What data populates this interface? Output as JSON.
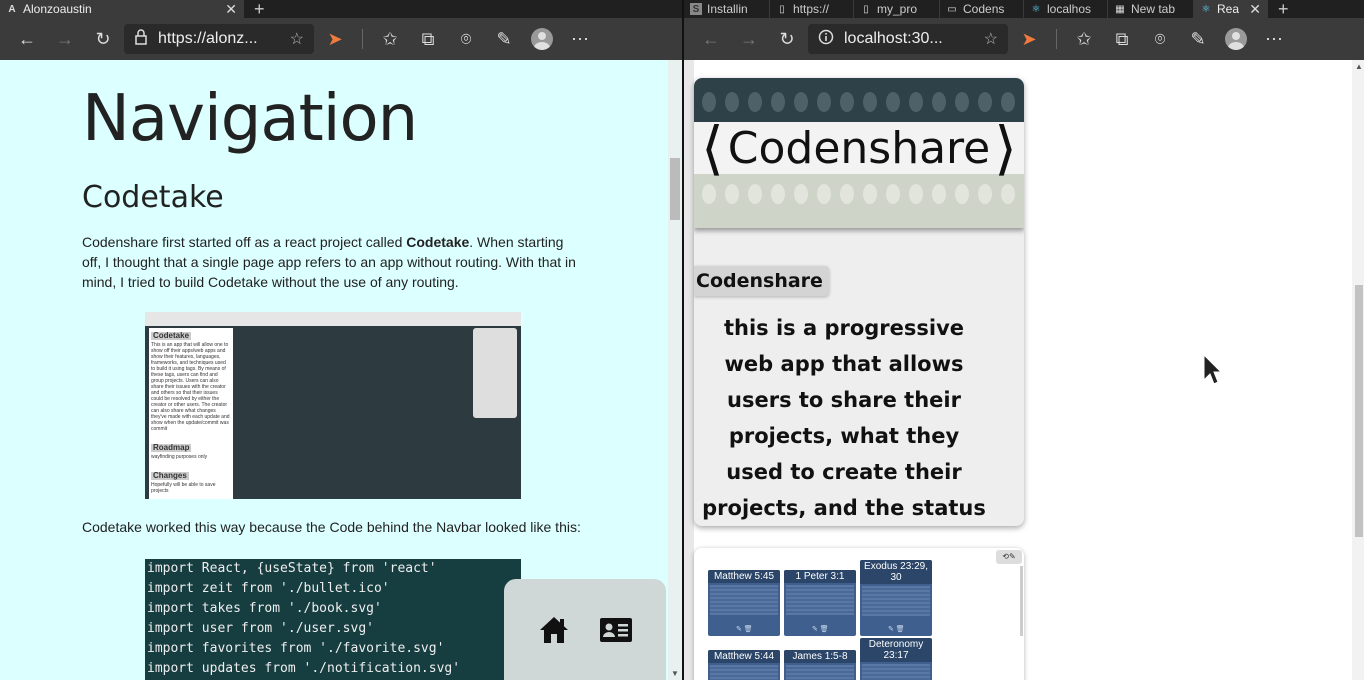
{
  "left_window": {
    "tab": {
      "title": "Alonzoaustin",
      "favicon": "A"
    },
    "address": "https://alonz...",
    "page": {
      "heading": "Navigation",
      "subheading": "Codetake",
      "intro_before": "Codenshare first started off as a react project called ",
      "intro_bold": "Codetake",
      "intro_after": ". When starting off, I thought that a single page app refers to an app without routing. With that in mind, I tried to build Codetake without the use of any routing.",
      "screenshot": {
        "sidebar_title": "Codetake",
        "sidebar_text": "This is an app that will allow one to show off their apps/web apps and show their features, languages, frameworks, and techniques used to build it using tags. By means of these tags, users can find and group projects. Users can also share their issues with the creator and others so that their issues could be resolved by either the creator or other users. The creator can also share what changes they've made with each update and show when the update/commit was commit",
        "roadmap_title": "Roadmap",
        "roadmap_text": "wayfinding purposes only",
        "changes_title": "Changes",
        "changes_text": "Hopefully will be able to save projects"
      },
      "line2": "Codetake worked this way because the Code behind the Navbar looked like this:",
      "code_lines": [
        "import React, {useState} from 'react'",
        "import zeit from './bullet.ico'",
        "import takes from './book.svg'",
        "import user from './user.svg'",
        "import favorites from './favorite.svg'",
        "import updates from './notification.svg'"
      ]
    }
  },
  "right_window": {
    "tabs": [
      {
        "title": "Installin",
        "favicon": "S"
      },
      {
        "title": "https://",
        "favicon": "doc"
      },
      {
        "title": "my_pro",
        "favicon": "doc"
      },
      {
        "title": "Codens",
        "favicon": "card"
      },
      {
        "title": "localhos",
        "favicon": "react"
      },
      {
        "title": "New tab",
        "favicon": "grid"
      },
      {
        "title": "Rea",
        "favicon": "react"
      }
    ],
    "address": "localhost:30...",
    "page": {
      "banner_title": "Codenshare",
      "chip_label": "Codenshare",
      "description": "this is a progressive web app that allows users to share their projects, what they used to create their projects, and the status of their projects.",
      "notes": [
        {
          "label": "Matthew 5:45"
        },
        {
          "label": "1 Peter 3:1"
        },
        {
          "label": "Exodus 23:29, 30"
        },
        {
          "label": "Matthew 5:44"
        },
        {
          "label": "James 1:5-8"
        },
        {
          "label": "Deteronomy 23:17"
        }
      ]
    }
  }
}
